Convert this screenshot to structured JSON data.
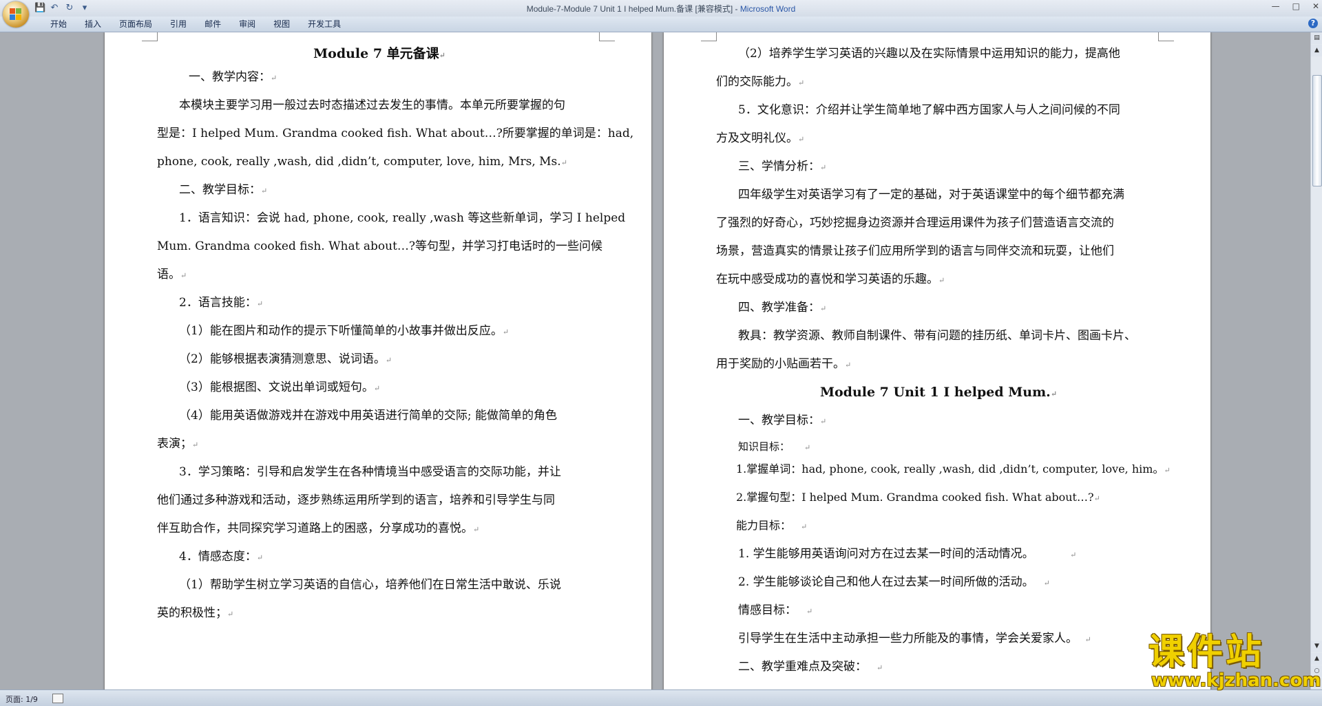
{
  "window": {
    "title": "Module-7-Module 7 Unit 1 I helped Mum.备课 [兼容模式] - ",
    "app_name": "Microsoft Word"
  },
  "ribbon": {
    "tabs": [
      "开始",
      "插入",
      "页面布局",
      "引用",
      "邮件",
      "审阅",
      "视图",
      "开发工具"
    ]
  },
  "status": {
    "page": "页面: 1/9"
  },
  "left_page": {
    "paragraphs": [
      {
        "text": "Module 7 单元备课"
      },
      {
        "text": "一、教学内容："
      },
      {
        "text": "本模块主要学习用一般过去时态描述过去发生的事情。本单元所要掌握的句"
      },
      {
        "text": "型是：I helped Mum. Grandma cooked fish. What about…?所要掌握的单词是：had,"
      },
      {
        "text": "phone, cook, really ,wash, did ,didn’t, computer, love, him, Mrs, Ms."
      },
      {
        "text": "二、教学目标："
      },
      {
        "text": "1．语言知识：会说 had, phone, cook, really ,wash 等这些新单词，学习 I helped"
      },
      {
        "text": "Mum. Grandma cooked fish. What about…?等句型，并学习打电话时的一些问候"
      },
      {
        "text": "语。"
      },
      {
        "text": "2．语言技能："
      },
      {
        "text": "（1）能在图片和动作的提示下听懂简单的小故事并做出反应。"
      },
      {
        "text": "（2）能够根据表演猜测意思、说词语。"
      },
      {
        "text": "（3）能根据图、文说出单词或短句。"
      },
      {
        "text": "（4）能用英语做游戏并在游戏中用英语进行简单的交际; 能做简单的角色"
      },
      {
        "text": "表演；"
      },
      {
        "text": "3．学习策略：引导和启发学生在各种情境当中感受语言的交际功能，并让"
      },
      {
        "text": "他们通过多种游戏和活动，逐步熟练运用所学到的语言，培养和引导学生与同"
      },
      {
        "text": "伴互助合作，共同探究学习道路上的困惑，分享成功的喜悦。"
      },
      {
        "text": "4．情感态度："
      },
      {
        "text": "（1）帮助学生树立学习英语的自信心，培养他们在日常生活中敢说、乐说"
      },
      {
        "text": "英的积极性；"
      }
    ]
  },
  "right_page": {
    "paragraphs": [
      {
        "text": "（2）培养学生学习英语的兴趣以及在实际情景中运用知识的能力，提高他"
      },
      {
        "text": "们的交际能力。"
      },
      {
        "text": "5．文化意识：介绍并让学生简单地了解中西方国家人与人之间问候的不同"
      },
      {
        "text": "方及文明礼仪。"
      },
      {
        "text": "三、学情分析："
      },
      {
        "text": "四年级学生对英语学习有了一定的基础，对于英语课堂中的每个细节都充满"
      },
      {
        "text": "了强烈的好奇心，巧妙挖掘身边资源并合理运用课件为孩子们营造语言交流的"
      },
      {
        "text": "场景，营造真实的情景让孩子们应用所学到的语言与同伴交流和玩耍，让他们"
      },
      {
        "text": "在玩中感受成功的喜悦和学习英语的乐趣。"
      },
      {
        "text": "四、教学准备："
      },
      {
        "text": "教具：教学资源、教师自制课件、带有问题的挂历纸、单词卡片、图画卡片、"
      },
      {
        "text": "用于奖励的小贴画若干。"
      },
      {
        "text": "Module 7 Unit 1 I helped Mum."
      },
      {
        "text": "一、教学目标："
      },
      {
        "text": "知识目标："
      },
      {
        "text": "1.掌握单词：had, phone, cook, really ,wash, did ,didn’t, computer, love, him。"
      },
      {
        "text": "2.掌握句型：I helped Mum. Grandma cooked fish. What about…?"
      },
      {
        "text": "能力目标："
      },
      {
        "text": "1. 学生能够用英语询问对方在过去某一时间的活动情况。"
      },
      {
        "text": "2. 学生能够谈论自己和他人在过去某一时间所做的活动。"
      },
      {
        "text": "情感目标："
      },
      {
        "text": "引导学生在生活中主动承担一些力所能及的事情，学会关爱家人。"
      },
      {
        "text": "二、教学重难点及突破："
      }
    ]
  },
  "watermark": {
    "cn": "课件站",
    "url": "www.kjzhan.com"
  }
}
